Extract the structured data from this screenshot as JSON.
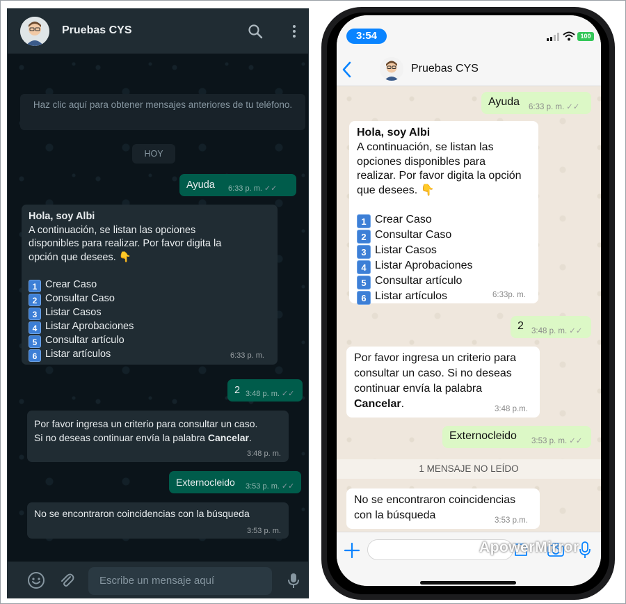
{
  "web": {
    "contact_name": "Pruebas CYS",
    "older_messages_notice": "Haz clic aquí para obtener mensajes anteriores de tu teléfono.",
    "day_divider": "HOY",
    "input_placeholder": "Escribe un mensaje aquí",
    "messages": [
      {
        "dir": "out",
        "text": "Ayuda",
        "time": "6:33 p. m."
      },
      {
        "dir": "in",
        "heading": "Hola, soy Albi",
        "intro": [
          "A continuación, se listan las opciones",
          "disponibles para realizar. Por favor digita la",
          "opción que desees. 👇"
        ],
        "options": [
          {
            "num": "1",
            "label": "Crear Caso"
          },
          {
            "num": "2",
            "label": "Consultar Caso"
          },
          {
            "num": "3",
            "label": "Listar Casos"
          },
          {
            "num": "4",
            "label": "Listar Aprobaciones"
          },
          {
            "num": "5",
            "label": "Consultar artículo"
          },
          {
            "num": "6",
            "label": "Listar artículos"
          }
        ],
        "time": "6:33 p. m."
      },
      {
        "dir": "out",
        "text": "2",
        "time": "3:48 p. m."
      },
      {
        "dir": "in",
        "lines": [
          "Por favor ingresa un criterio para consultar un caso.",
          "Si no deseas continuar envía la palabra "
        ],
        "bold": "Cancelar",
        "after": ".",
        "time": "3:48 p. m."
      },
      {
        "dir": "out",
        "text": "Externocleido",
        "time": "3:53 p. m."
      },
      {
        "dir": "in",
        "text": "No se encontraron coincidencias con la búsqueda",
        "time": "3:53 p. m."
      }
    ]
  },
  "phone": {
    "status_time": "3:54",
    "battery": "100",
    "contact_name": "Pruebas CYS",
    "unread_divider": "1 MENSAJE NO LEÍDO",
    "watermark": "ApowerMirror",
    "messages": [
      {
        "dir": "out",
        "text": "Ayuda",
        "time": "6:33 p. m."
      },
      {
        "dir": "in",
        "heading": "Hola, soy Albi",
        "intro": [
          "A continuación, se listan las",
          "opciones disponibles para",
          "realizar. Por favor digita la opción",
          "que desees. 👇"
        ],
        "options": [
          {
            "num": "1",
            "label": "Crear Caso"
          },
          {
            "num": "2",
            "label": "Consultar Caso"
          },
          {
            "num": "3",
            "label": "Listar Casos"
          },
          {
            "num": "4",
            "label": "Listar Aprobaciones"
          },
          {
            "num": "5",
            "label": "Consultar artículo"
          },
          {
            "num": "6",
            "label": "Listar artículos"
          }
        ],
        "time": "6:33p. m."
      },
      {
        "dir": "out",
        "text": "2",
        "time": "3:48 p. m."
      },
      {
        "dir": "in",
        "lines": [
          "Por favor ingresa un criterio para",
          "consultar un caso. Si no deseas",
          "continuar envía la palabra"
        ],
        "bold": "Cancelar",
        "after": ".",
        "time": "3:48 p.m."
      },
      {
        "dir": "out",
        "text": "Externocleido",
        "time": "3:53 p. m."
      },
      {
        "dir": "in",
        "lines": [
          "No se encontraron coincidencias",
          "con la búsqueda"
        ],
        "time": "3:53 p.m."
      }
    ]
  },
  "colors": {
    "web_bg": "#0b141a",
    "web_out": "#005c4b",
    "web_in": "#202c33",
    "phone_out": "#dcf8c6",
    "phone_in": "#ffffff",
    "ios_blue": "#0a84ff"
  }
}
